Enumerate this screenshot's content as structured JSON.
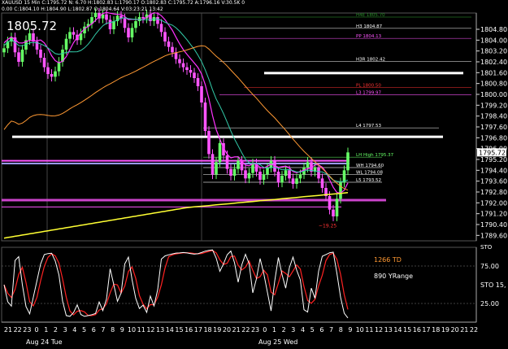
{
  "header": {
    "line1": "XAUUSD 15 Min C:1795.72 N: 6.70 H:1802.83 L:1790.17 O:1802.83 C:1795.72 A:1796.16 V:30.5K 0",
    "line2": "0.00 C:1804.10 H:1804.90 L:1802.87 O:1804.64 V:03:23:21 13:42"
  },
  "current_price_label": "1805.72",
  "last_price_tag": "1795.72",
  "chart_data": {
    "type": "line",
    "title": "",
    "xlabel": "",
    "ylabel": "",
    "price_axis_ticks": [
      "1804.80",
      "1804.00",
      "1803.20",
      "1802.40",
      "1801.60",
      "1800.80",
      "1800.00",
      "1799.20",
      "1798.40",
      "1797.60",
      "1796.80",
      "1796.00",
      "1795.20",
      "1794.40",
      "1793.60",
      "1792.80",
      "1792.00",
      "1791.20",
      "1790.40",
      "1789.60"
    ],
    "ylim": [
      1789.2,
      1806.0
    ],
    "time_axis_labels": [
      "21",
      "22",
      "23",
      "0",
      "1",
      "2",
      "3",
      "4",
      "5",
      "6",
      "7",
      "8",
      "9",
      "10",
      "11",
      "12",
      "13",
      "14",
      "15",
      "16",
      "17",
      "18",
      "19",
      "20",
      "21",
      "22",
      "23",
      "0",
      "1",
      "2",
      "3",
      "4",
      "5",
      "6",
      "7",
      "8",
      "9",
      "10",
      "11",
      "12",
      "13",
      "14",
      "15",
      "16",
      "17",
      "18",
      "19",
      "20",
      "21",
      "22"
    ],
    "date_labels": [
      "Aug 24 Tue",
      "Aug 25 Wed"
    ],
    "level_labels": [
      {
        "text": "H4E 1805.70",
        "price": 1805.7,
        "color": "#2d8f2d"
      },
      {
        "text": "H3 1804.87",
        "price": 1804.87,
        "color": "#ffffff"
      },
      {
        "text": "PP 1804.13",
        "price": 1804.13,
        "color": "#ff55ff"
      },
      {
        "text": "H3R 1802.42",
        "price": 1802.42,
        "color": "#ffffff"
      },
      {
        "text": "PL 1800.50",
        "price": 1800.5,
        "color": "#ff3333"
      },
      {
        "text": "L3 1799.97",
        "price": 1799.97,
        "color": "#ff55ff"
      },
      {
        "text": "L4 1797.53",
        "price": 1797.53,
        "color": "#ffffff"
      },
      {
        "text": "LH High 1795.37",
        "price": 1795.37,
        "color": "#66ff66"
      },
      {
        "text": "WH 1794.60",
        "price": 1794.6,
        "color": "#ffffff"
      },
      {
        "text": "WL 1794.08",
        "price": 1794.08,
        "color": "#ffffff"
      },
      {
        "text": "L5 1793.52",
        "price": 1793.52,
        "color": "#ffffff"
      }
    ],
    "low_marker": "~19.25",
    "bars": [
      1803.4,
      1803.9,
      1804.2,
      1803.1,
      1802.4,
      1803.3,
      1804.0,
      1804.5,
      1803.9,
      1803.3,
      1802.7,
      1802.0,
      1801.5,
      1801.3,
      1801.7,
      1802.4,
      1803.3,
      1804.1,
      1804.6,
      1804.4,
      1804.0,
      1804.5,
      1805.0,
      1805.2,
      1805.7,
      1806.0,
      1805.6,
      1805.9,
      1805.5,
      1804.8,
      1805.4,
      1805.8,
      1805.6,
      1804.9,
      1804.2,
      1804.9,
      1805.4,
      1805.7,
      1805.6,
      1805.9,
      1805.4,
      1805.7,
      1805.2,
      1804.6,
      1803.9,
      1803.5,
      1803.1,
      1802.6,
      1802.3,
      1802.0,
      1801.8,
      1801.6,
      1801.2,
      1800.6,
      1799.4,
      1797.3,
      1795.6,
      1794.1,
      1795.0,
      1796.4,
      1795.5,
      1794.5,
      1794.0,
      1794.5,
      1795.1,
      1794.4,
      1793.8,
      1794.2,
      1794.9,
      1794.3,
      1793.7,
      1794.1,
      1794.6,
      1795.1,
      1794.3,
      1793.5,
      1794.0,
      1794.4,
      1793.8,
      1793.4,
      1793.8,
      1794.1,
      1794.6,
      1795.0,
      1794.3,
      1794.6,
      1793.8,
      1793.1,
      1792.5,
      1791.5,
      1791.0,
      1792.3,
      1793.5,
      1794.4,
      1795.72
    ],
    "oscillator": {
      "name": "STO",
      "period_label": "STO 15,",
      "levels": [
        "25.00",
        "75.00"
      ],
      "notes": [
        "1266 TD",
        "890 YRange"
      ]
    }
  },
  "colors": {
    "background": "#000000",
    "up_bar": "#66ff66",
    "down_bar": "#ff55ff",
    "ma_magenta": "#ff33ff",
    "ma_teal": "#33ccaa",
    "ma_orange": "#ff9933",
    "ma_yellow": "#ffff33",
    "sto_k": "#ffffff",
    "sto_d": "#ff2222",
    "td_text": "#ff9933"
  }
}
